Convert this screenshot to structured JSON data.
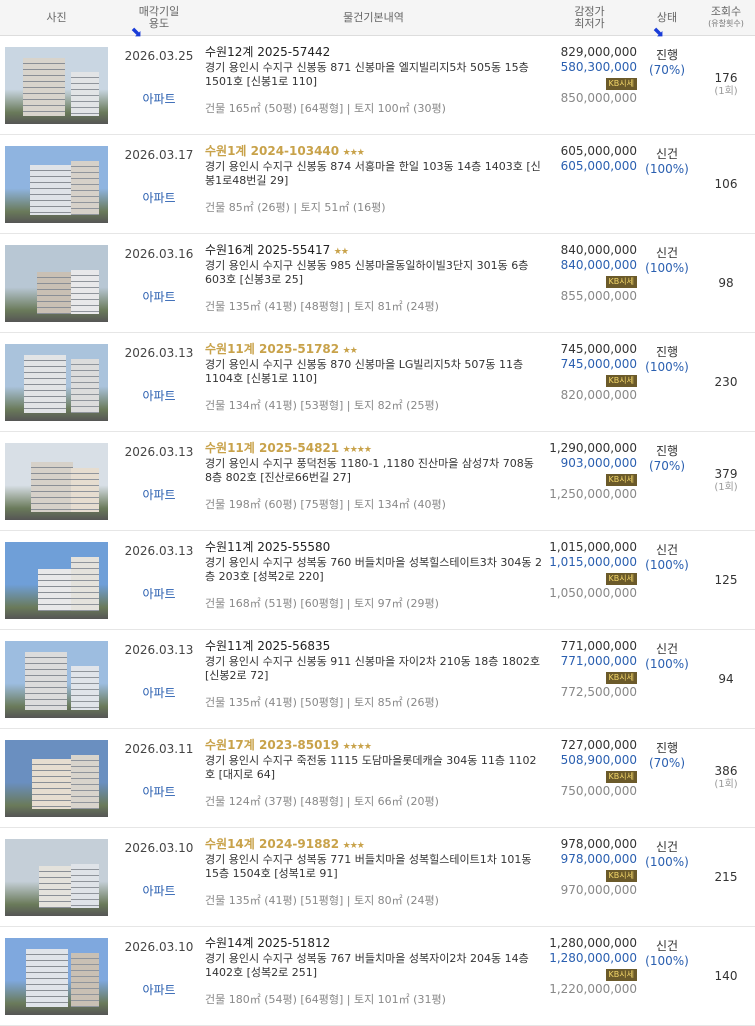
{
  "header": {
    "photo": "사진",
    "date_line1": "매각기일",
    "date_line2": "용도",
    "info": "물건기본내역",
    "price_line1": "감정가",
    "price_line2": "최저가",
    "status": "상태",
    "views_line1": "조회수",
    "views_line2": "(유찰횟수)"
  },
  "colors": {
    "accent_blue": "#2a5fb0",
    "gold": "#c8a24a",
    "arrow": "#1a3cd8"
  },
  "rows": [
    {
      "date": "2026.03.25",
      "type": "아파트",
      "case": "수원12계 2025-57442",
      "gold": false,
      "stars": "",
      "addr": "경기 용인시 수지구 신봉동 871 신봉마을 엘지빌리지5차 505동 15층 1501호 [신봉1로 110]",
      "area": "건물 165㎡ (50평) [64평형]  |  토지 100㎡ (30평)",
      "appraisal": "829,000,000",
      "minimum": "580,300,000",
      "badge": "KB시세",
      "sale": "850,000,000",
      "status": "진행",
      "pct": "(70%)",
      "views": "176",
      "fail": "(1회)"
    },
    {
      "date": "2026.03.17",
      "type": "아파트",
      "case": "수원1계 2024-103440",
      "gold": true,
      "stars": "★★★",
      "addr": "경기 용인시 수지구 신봉동 874 서홍마을 한일 103동 14층 1403호 [신봉1로48번길 29]",
      "area": "건물 85㎡ (26평)  |  토지 51㎡ (16평)",
      "appraisal": "605,000,000",
      "minimum": "605,000,000",
      "badge": "",
      "sale": "",
      "status": "신건",
      "pct": "(100%)",
      "views": "106",
      "fail": ""
    },
    {
      "date": "2026.03.16",
      "type": "아파트",
      "case": "수원16계 2025-55417",
      "gold": false,
      "stars": "★★",
      "addr": "경기 용인시 수지구 신봉동 985 신봉마을동일하이빌3단지 301동 6층 603호 [신봉3로 25]",
      "area": "건물 135㎡ (41평) [48평형]  |  토지 81㎡ (24평)",
      "appraisal": "840,000,000",
      "minimum": "840,000,000",
      "badge": "KB시세",
      "sale": "855,000,000",
      "status": "신건",
      "pct": "(100%)",
      "views": "98",
      "fail": ""
    },
    {
      "date": "2026.03.13",
      "type": "아파트",
      "case": "수원11계 2025-51782",
      "gold": true,
      "stars": "★★",
      "addr": "경기 용인시 수지구 신봉동 870 신봉마을 LG빌리지5차 507동 11층 1104호 [신봉1로 110]",
      "area": "건물 134㎡ (41평) [53평형]  |  토지 82㎡ (25평)",
      "appraisal": "745,000,000",
      "minimum": "745,000,000",
      "badge": "KB시세",
      "sale": "820,000,000",
      "status": "진행",
      "pct": "(100%)",
      "views": "230",
      "fail": ""
    },
    {
      "date": "2026.03.13",
      "type": "아파트",
      "case": "수원11계 2025-54821",
      "gold": true,
      "stars": "★★★★",
      "addr": "경기 용인시 수지구 풍덕천동 1180-1 ,1180 진산마을 삼성7차 708동 8층 802호 [진산로66번길 27]",
      "area": "건물 198㎡ (60평) [75평형]  |  토지 134㎡ (40평)",
      "appraisal": "1,290,000,000",
      "minimum": "903,000,000",
      "badge": "KB시세",
      "sale": "1,250,000,000",
      "status": "진행",
      "pct": "(70%)",
      "views": "379",
      "fail": "(1회)"
    },
    {
      "date": "2026.03.13",
      "type": "아파트",
      "case": "수원11계 2025-55580",
      "gold": false,
      "stars": "",
      "addr": "경기 용인시 수지구 성복동 760 버들치마을 성복힐스테이트3차 304동 2층 203호 [성복2로 220]",
      "area": "건물 168㎡ (51평) [60평형]  |  토지 97㎡ (29평)",
      "appraisal": "1,015,000,000",
      "minimum": "1,015,000,000",
      "badge": "KB시세",
      "sale": "1,050,000,000",
      "status": "신건",
      "pct": "(100%)",
      "views": "125",
      "fail": ""
    },
    {
      "date": "2026.03.13",
      "type": "아파트",
      "case": "수원11계 2025-56835",
      "gold": false,
      "stars": "",
      "addr": "경기 용인시 수지구 신봉동 911 신봉마을 자이2차 210동 18층 1802호 [신봉2로 72]",
      "area": "건물 135㎡ (41평) [50평형]  |  토지 85㎡ (26평)",
      "appraisal": "771,000,000",
      "minimum": "771,000,000",
      "badge": "KB시세",
      "sale": "772,500,000",
      "status": "신건",
      "pct": "(100%)",
      "views": "94",
      "fail": ""
    },
    {
      "date": "2026.03.11",
      "type": "아파트",
      "case": "수원17계 2023-85019",
      "gold": true,
      "stars": "★★★★",
      "addr": "경기 용인시 수지구 죽전동 1115 도담마을롯데캐슬 304동 11층 1102호 [대지로 64]",
      "area": "건물 124㎡ (37평) [48평형]  |  토지 66㎡ (20평)",
      "appraisal": "727,000,000",
      "minimum": "508,900,000",
      "badge": "KB시세",
      "sale": "750,000,000",
      "status": "진행",
      "pct": "(70%)",
      "views": "386",
      "fail": "(1회)"
    },
    {
      "date": "2026.03.10",
      "type": "아파트",
      "case": "수원14계 2024-91882",
      "gold": true,
      "stars": "★★★",
      "addr": "경기 용인시 수지구 성복동 771 버들치마을 성복힐스테이트1차 101동 15층 1504호 [성복1로 91]",
      "area": "건물 135㎡ (41평) [51평형]  |  토지 80㎡ (24평)",
      "appraisal": "978,000,000",
      "minimum": "978,000,000",
      "badge": "KB시세",
      "sale": "970,000,000",
      "status": "신건",
      "pct": "(100%)",
      "views": "215",
      "fail": ""
    },
    {
      "date": "2026.03.10",
      "type": "아파트",
      "case": "수원14계 2025-51812",
      "gold": false,
      "stars": "",
      "addr": "경기 용인시 수지구 성복동 767 버들치마을 성복자이2차 204동 14층 1402호 [성복2로 251]",
      "area": "건물 180㎡ (54평) [64평형]  |  토지 101㎡ (31평)",
      "appraisal": "1,280,000,000",
      "minimum": "1,280,000,000",
      "badge": "KB시세",
      "sale": "1,220,000,000",
      "status": "신건",
      "pct": "(100%)",
      "views": "140",
      "fail": ""
    }
  ]
}
